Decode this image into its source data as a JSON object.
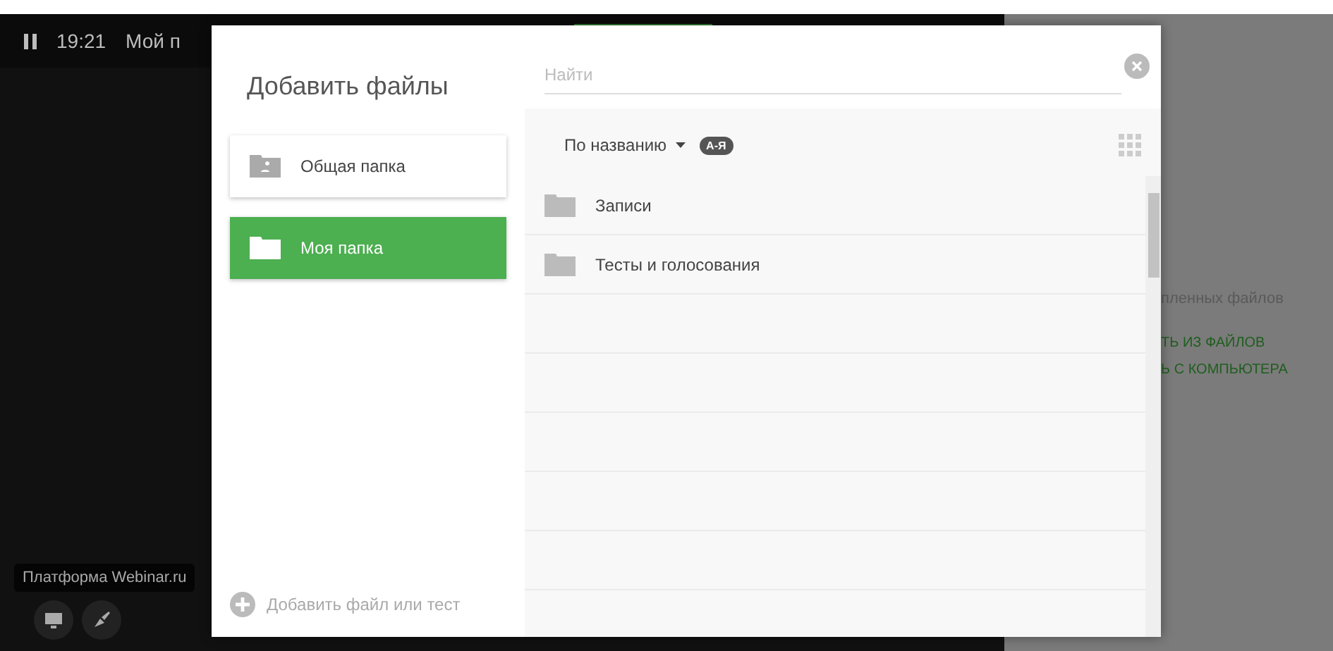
{
  "top_bar": {
    "time": "19:21",
    "title": "Мой п"
  },
  "side_panel": {
    "lines": [
      {
        "text": "пленных файлов",
        "kind": "note"
      },
      {
        "text": "ТЬ ИЗ ФАЙЛОВ",
        "kind": "action"
      },
      {
        "text": "Ь С КОМПЬЮТЕРА",
        "kind": "action"
      }
    ]
  },
  "platform_tooltip": "Платформа Webinar.ru",
  "dialog": {
    "title": "Добавить файлы",
    "folders": [
      {
        "label": "Общая папка",
        "kind": "shared",
        "selected": false
      },
      {
        "label": "Моя папка",
        "kind": "personal",
        "selected": true
      }
    ],
    "add_label": "Добавить файл или тест",
    "search": {
      "placeholder": "Найти"
    },
    "sort": {
      "label": "По названию",
      "order": "А-Я"
    },
    "files": [
      {
        "name": "Записи",
        "kind": "folder"
      },
      {
        "name": "Тесты и голосования",
        "kind": "folder"
      }
    ]
  }
}
